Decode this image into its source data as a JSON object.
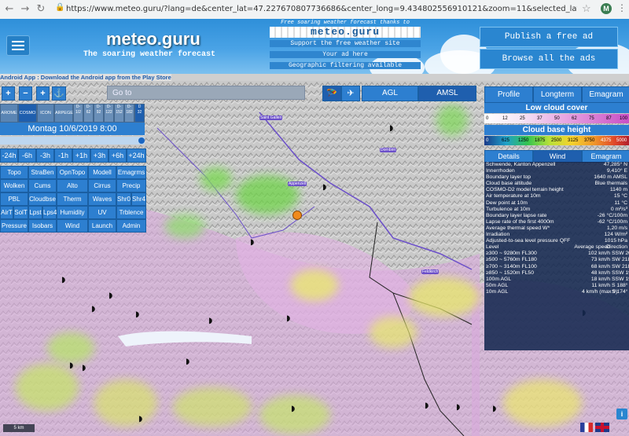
{
  "browser": {
    "url": "https://www.meteo.guru/?lang=de&center_lat=47.227670807736686&center_long=9.434802556910121&zoom=11&selected_lat=47.285&selected_long=9.41&...",
    "profile_letter": "M"
  },
  "header": {
    "title": "meteo.guru",
    "subtitle": "The soaring weather forecast",
    "ad": {
      "thanks": "Free soaring weather forecast thanks to",
      "banner": "meteo.guru",
      "line1": "Support the free weather site",
      "line2": "Your ad here",
      "line3": "Geographic filtering available"
    },
    "publish_ad": "Publish a free ad",
    "browse_ads": "Browse all the ads"
  },
  "android_notice": "Android App : Download the Android app from the Play Store",
  "controls": {
    "zoom_in": "+",
    "zoom_out": "−",
    "add": "+",
    "goto_placeholder": "Go to",
    "models": [
      "AROME",
      "COSMO",
      "ICON",
      "ARPEGE"
    ],
    "model_small": [
      {
        "top": "D-",
        "bottom": "1/2"
      },
      {
        "top": "D-",
        "bottom": "62"
      },
      {
        "top": "D-",
        "bottom": "92"
      },
      {
        "top": "D-",
        "bottom": "122"
      },
      {
        "top": "D-",
        "bottom": "152"
      },
      {
        "top": "D-",
        "bottom": "182"
      },
      {
        "top": "D",
        "bottom": "32"
      }
    ],
    "date": "Montag 10/6/2019 8:00",
    "steps": [
      "-24h",
      "-6h",
      "-3h",
      "-1h",
      "+1h",
      "+3h",
      "+6h",
      "+24h"
    ],
    "layers": [
      [
        "Topo",
        "StraBen",
        "OpnTopo",
        "Modell",
        "Emagrms"
      ],
      [
        "Wolken",
        "Cums",
        "Alto",
        "Cirrus",
        "Precip"
      ],
      [
        "PBL",
        "Cloudbse",
        "Therm",
        "Waves",
        "Shr0"
      ],
      [
        "AirT",
        "SolT",
        "Lpst",
        "Humidity",
        "UV",
        "Trblence"
      ],
      [
        "Pressure",
        "Isobars",
        "Wind",
        "Launch",
        "Admin"
      ]
    ],
    "extra_layer": "Shr4",
    "extra_layers_row4": [
      "Lps4"
    ],
    "agl": "AGL",
    "amsl": "AMSL"
  },
  "right_panel": {
    "tabs": [
      "Profile",
      "Longterm",
      "Emagram"
    ],
    "low_cloud_title": "Low cloud cover",
    "low_cloud_scale": [
      "0",
      "12",
      "25",
      "37",
      "50",
      "62",
      "75",
      "87",
      "100"
    ],
    "cloud_base_title": "Cloud base height",
    "cloud_base_scale": [
      "0",
      "625",
      "1250",
      "1875",
      "2500",
      "3125",
      "3750",
      "4375",
      "5000"
    ],
    "detail_tabs": [
      "Details",
      "Wind",
      "Emagram"
    ],
    "rows": [
      {
        "label": "Schwende, Kanton Appenzell",
        "value": "47,285° N"
      },
      {
        "label": "Innerrhoden",
        "value": "9,410° E"
      },
      {
        "label": "Boundary layer top",
        "value": "1640 m AMSL"
      },
      {
        "label": "Cloud base altitude",
        "value": "Blue thermals"
      },
      {
        "label": "COSMO-D2 model terrain height",
        "value": "1140 m"
      },
      {
        "label": "Air temperature at 10m",
        "value": "15 °C"
      },
      {
        "label": "Dew point at 10m",
        "value": "11 °C"
      },
      {
        "label": "Turbulence at 10m",
        "value": "0 m²/s³"
      },
      {
        "label": "Boundary layer lapse rate",
        "value": "-26 °C/100m"
      },
      {
        "label": "Lapse rate of the first 4000m",
        "value": "-62 °C/100m"
      },
      {
        "label": "Average thermal speed W*",
        "value": "1,20 m/s"
      },
      {
        "label": "Irradiation",
        "value": "124 W/m²"
      },
      {
        "label": "Adjusted-to-sea level pressure QFF",
        "value": "1015 hPa"
      }
    ],
    "wind_header": {
      "level": "Level",
      "speed": "Average speed",
      "dir": "Direction"
    },
    "wind_rows": [
      {
        "level": "≥300 ~ 9280m FL300",
        "speed": "102 km/h",
        "dir": "SSW 200°"
      },
      {
        "level": "≥500 ~ 5760m FL180",
        "speed": "73 km/h",
        "dir": "SW 218°"
      },
      {
        "level": "≥700 ~ 3140m FL100",
        "speed": "68 km/h",
        "dir": "SW 218°"
      },
      {
        "level": "≥850 ~ 1520m FL50",
        "speed": "48 km/h",
        "dir": "SSW 198°"
      },
      {
        "level": "100m AGL",
        "speed": "18 km/h",
        "dir": "SSW 193°"
      },
      {
        "level": "50m AGL",
        "speed": "11 km/h",
        "dir": "S 188°"
      },
      {
        "level": "10m AGL",
        "speed": "4 km/h (max 9)",
        "dir": "S 174°"
      }
    ]
  },
  "map": {
    "scale": "5 km",
    "info": "i",
    "place_labels": [
      "Saint Gallen",
      "Appenzell",
      "Feldkirch",
      "Dornbirn"
    ]
  }
}
